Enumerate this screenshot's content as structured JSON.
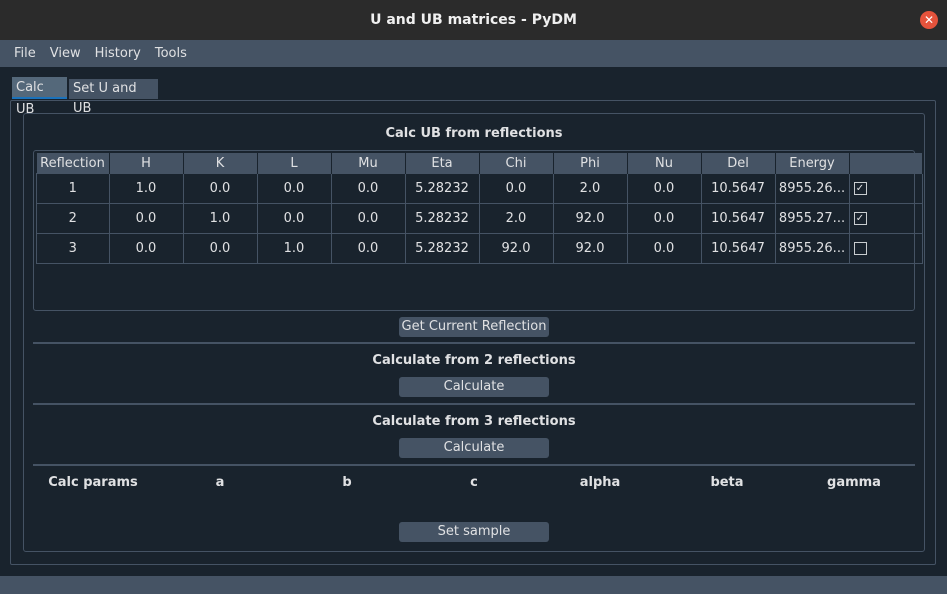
{
  "window": {
    "title": "U and UB matrices - PyDM"
  },
  "menu": [
    "File",
    "View",
    "History",
    "Tools"
  ],
  "tabs": [
    "Calc UB",
    "Set U and UB"
  ],
  "calc_from_reflections": {
    "title": "Calc UB from reflections",
    "headers": [
      "Reflection",
      "H",
      "K",
      "L",
      "Mu",
      "Eta",
      "Chi",
      "Phi",
      "Nu",
      "Del",
      "Energy",
      ""
    ],
    "rows": [
      {
        "cells": [
          "1",
          "1.0",
          "0.0",
          "0.0",
          "0.0",
          "5.28232",
          "0.0",
          "2.0",
          "0.0",
          "10.5647",
          "8955.26..."
        ],
        "checked": true
      },
      {
        "cells": [
          "2",
          "0.0",
          "1.0",
          "0.0",
          "0.0",
          "5.28232",
          "2.0",
          "92.0",
          "0.0",
          "10.5647",
          "8955.27..."
        ],
        "checked": true
      },
      {
        "cells": [
          "3",
          "0.0",
          "0.0",
          "1.0",
          "0.0",
          "5.28232",
          "92.0",
          "92.0",
          "0.0",
          "10.5647",
          "8955.26..."
        ],
        "checked": false
      }
    ],
    "get_current_label": "Get Current Reflection"
  },
  "calc2": {
    "title": "Calculate from 2 reflections",
    "button": "Calculate"
  },
  "calc3": {
    "title": "Calculate from 3 reflections",
    "button": "Calculate"
  },
  "params": {
    "labels": [
      "Calc params",
      "a",
      "b",
      "c",
      "alpha",
      "beta",
      "gamma"
    ]
  },
  "set_sample_label": "Set sample",
  "icons": {
    "close": "close-icon",
    "check": "checkmark-icon"
  },
  "colors": {
    "background": "#19232d",
    "panel": "#455364",
    "accent": "#1a72bb",
    "close": "#e5533c"
  }
}
